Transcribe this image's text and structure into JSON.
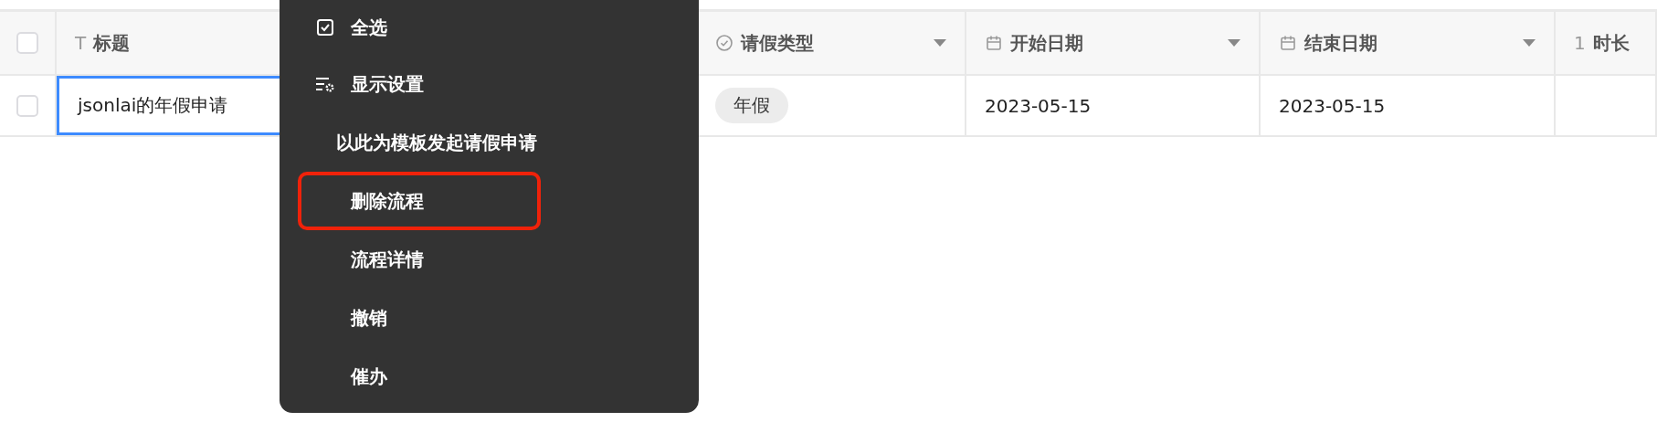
{
  "table": {
    "columns": [
      {
        "kind": "checkbox",
        "checked": false
      },
      {
        "kind": "text-field",
        "label": "标题",
        "glyph": "T"
      },
      {
        "kind": "select-field",
        "label": "请假类型",
        "dropdown": true
      },
      {
        "kind": "date-field",
        "label": "开始日期",
        "dropdown": true
      },
      {
        "kind": "date-field",
        "label": "结束日期",
        "dropdown": true
      },
      {
        "kind": "number-field",
        "label": "时长",
        "glyph": "1"
      }
    ],
    "rows": [
      {
        "cells": [
          {
            "kind": "checkbox",
            "checked": false
          },
          {
            "kind": "text",
            "value": "jsonlai的年假申请",
            "selected": true
          },
          {
            "kind": "tag",
            "value": "年假",
            "selected": false
          },
          {
            "kind": "text",
            "value": "2023-05-15",
            "selected": false
          },
          {
            "kind": "text",
            "value": "2023-05-15",
            "selected": false
          },
          {
            "kind": "empty",
            "selected": false
          }
        ]
      }
    ]
  },
  "context_menu": {
    "items": [
      {
        "kind": "checkbox-item",
        "label": "全选",
        "highlighted": false
      },
      {
        "kind": "settings-item",
        "label": "显示设置",
        "highlighted": false
      },
      {
        "kind": "plain",
        "label": "以此为模板发起请假申请",
        "highlighted": false
      },
      {
        "kind": "plain",
        "label": "删除流程",
        "highlighted": true
      },
      {
        "kind": "plain",
        "label": "流程详情",
        "highlighted": false
      },
      {
        "kind": "plain",
        "label": "撤销",
        "highlighted": false
      },
      {
        "kind": "plain",
        "label": "催办",
        "highlighted": false
      }
    ]
  }
}
